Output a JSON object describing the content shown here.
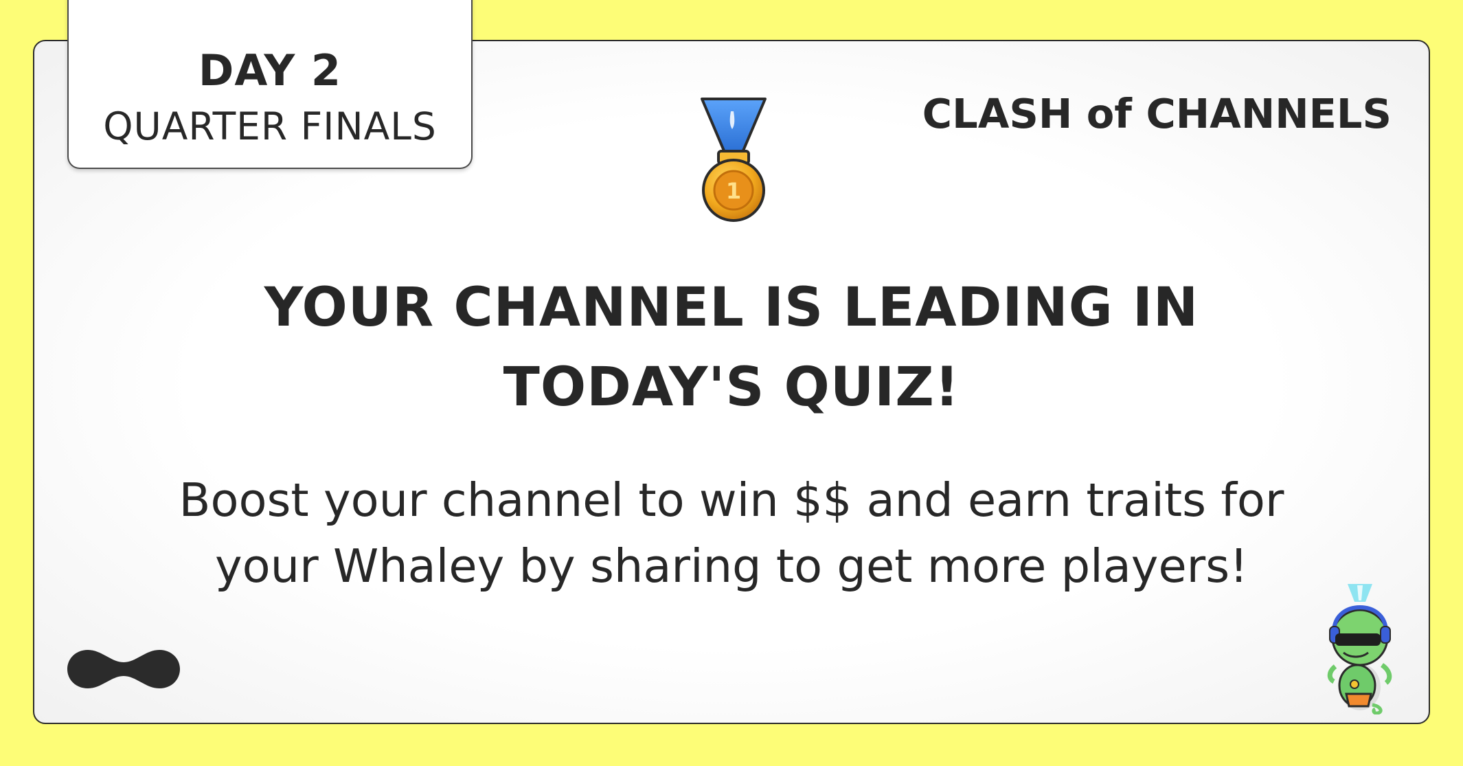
{
  "tag": {
    "day": "DAY 2",
    "round": "QUARTER FINALS"
  },
  "brand": {
    "title": "CLASH of CHANNELS"
  },
  "medal": {
    "icon": "gold-medal-icon",
    "number": "1"
  },
  "headline": {
    "line1": "YOUR CHANNEL IS LEADING IN",
    "line2": "TODAY'S QUIZ!"
  },
  "message": {
    "line1": "Boost your channel to win $$ and earn traits for",
    "line2": "your Whaley by sharing to get more players!"
  },
  "icons": {
    "logo": "infinity-logo-icon",
    "mascot": "whaley-mascot-icon"
  },
  "colors": {
    "background": "#FDFD77",
    "card": "#FFFFFF",
    "text": "#272727",
    "medal_gold": "#F2A91E",
    "ribbon_blue": "#3F86E8"
  }
}
